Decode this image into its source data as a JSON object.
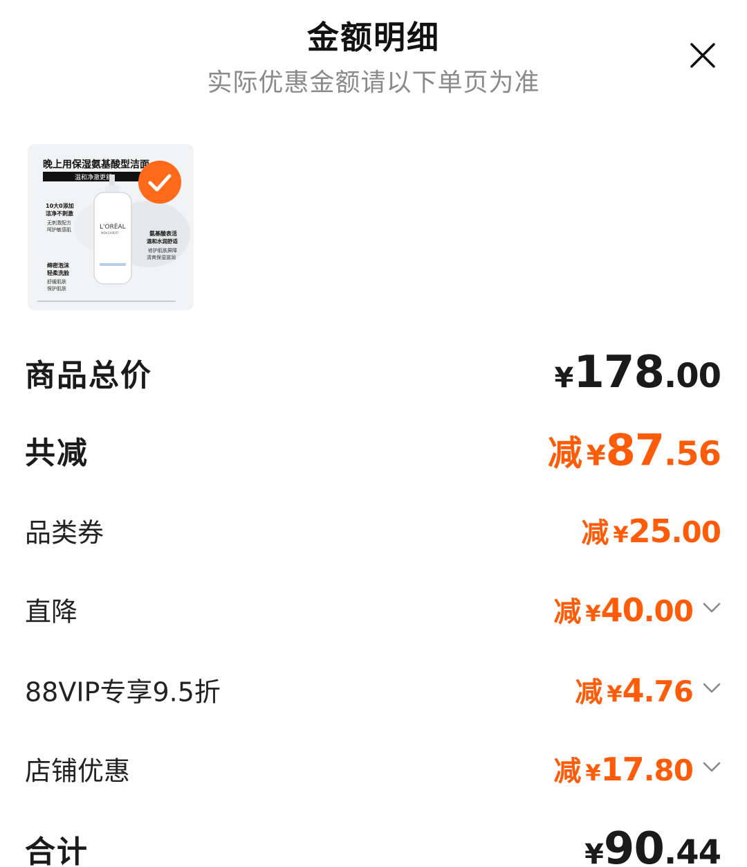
{
  "header": {
    "title": "金额明细",
    "subtitle": "实际优惠金额请以下单页为准"
  },
  "product": {
    "image_text": {
      "headline": "晚上用保湿氨基酸型洁面",
      "tagline": "温和净澈更舒",
      "left_notes": [
        "10大0添加",
        "洁净不刺激",
        "无刺激配方",
        "呵护敏感肌"
      ],
      "brand": "L'ORÉAL",
      "brand_sub": "MEN EXPERT",
      "right_notes": [
        "氨基酸表活",
        "温和水润舒适",
        "修护肌肤屏障",
        "清爽保湿滋润"
      ],
      "bottom_notes": [
        "绵密泡沫",
        "轻柔洗脸",
        "舒缓肌肤",
        "保护肌肤"
      ]
    },
    "selected": true
  },
  "rows": {
    "total_price": {
      "label": "商品总价",
      "currency": "¥",
      "int": "178",
      "dec": ".00"
    },
    "total_discount": {
      "label": "共减",
      "prefix": "减",
      "currency": "¥",
      "int": "87",
      "dec": ".56"
    },
    "category_coupon": {
      "label": "品类券",
      "prefix": "减",
      "currency": "¥",
      "int": "25",
      "dec": ".00"
    },
    "direct_drop": {
      "label": "直降",
      "prefix": "减",
      "currency": "¥",
      "int": "40",
      "dec": ".00"
    },
    "vip": {
      "label": "88VIP专享9.5折",
      "prefix": "减",
      "currency": "¥",
      "int": "4",
      "dec": ".76"
    },
    "shop": {
      "label": "店铺优惠",
      "prefix": "减",
      "currency": "¥",
      "int": "17",
      "dec": ".80"
    },
    "sum": {
      "label": "合计",
      "currency": "¥",
      "int": "90",
      "dec": ".44"
    }
  },
  "colors": {
    "accent": "#ff5c0a",
    "text": "#1a1a1a",
    "muted": "#8a8a8a"
  },
  "icons": {
    "close": "close-icon",
    "check": "check-icon",
    "chevron": "chevron-down-icon"
  }
}
